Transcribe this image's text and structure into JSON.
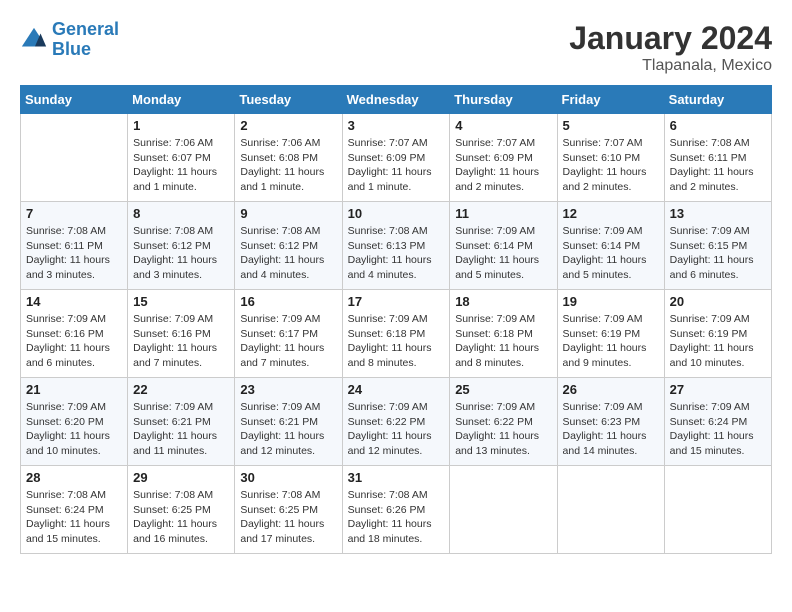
{
  "header": {
    "logo_line1": "General",
    "logo_line2": "Blue",
    "title": "January 2024",
    "subtitle": "Tlapanala, Mexico"
  },
  "weekdays": [
    "Sunday",
    "Monday",
    "Tuesday",
    "Wednesday",
    "Thursday",
    "Friday",
    "Saturday"
  ],
  "weeks": [
    [
      {
        "day": "",
        "info": ""
      },
      {
        "day": "1",
        "info": "Sunrise: 7:06 AM\nSunset: 6:07 PM\nDaylight: 11 hours\nand 1 minute."
      },
      {
        "day": "2",
        "info": "Sunrise: 7:06 AM\nSunset: 6:08 PM\nDaylight: 11 hours\nand 1 minute."
      },
      {
        "day": "3",
        "info": "Sunrise: 7:07 AM\nSunset: 6:09 PM\nDaylight: 11 hours\nand 1 minute."
      },
      {
        "day": "4",
        "info": "Sunrise: 7:07 AM\nSunset: 6:09 PM\nDaylight: 11 hours\nand 2 minutes."
      },
      {
        "day": "5",
        "info": "Sunrise: 7:07 AM\nSunset: 6:10 PM\nDaylight: 11 hours\nand 2 minutes."
      },
      {
        "day": "6",
        "info": "Sunrise: 7:08 AM\nSunset: 6:11 PM\nDaylight: 11 hours\nand 2 minutes."
      }
    ],
    [
      {
        "day": "7",
        "info": "Sunrise: 7:08 AM\nSunset: 6:11 PM\nDaylight: 11 hours\nand 3 minutes."
      },
      {
        "day": "8",
        "info": "Sunrise: 7:08 AM\nSunset: 6:12 PM\nDaylight: 11 hours\nand 3 minutes."
      },
      {
        "day": "9",
        "info": "Sunrise: 7:08 AM\nSunset: 6:12 PM\nDaylight: 11 hours\nand 4 minutes."
      },
      {
        "day": "10",
        "info": "Sunrise: 7:08 AM\nSunset: 6:13 PM\nDaylight: 11 hours\nand 4 minutes."
      },
      {
        "day": "11",
        "info": "Sunrise: 7:09 AM\nSunset: 6:14 PM\nDaylight: 11 hours\nand 5 minutes."
      },
      {
        "day": "12",
        "info": "Sunrise: 7:09 AM\nSunset: 6:14 PM\nDaylight: 11 hours\nand 5 minutes."
      },
      {
        "day": "13",
        "info": "Sunrise: 7:09 AM\nSunset: 6:15 PM\nDaylight: 11 hours\nand 6 minutes."
      }
    ],
    [
      {
        "day": "14",
        "info": "Sunrise: 7:09 AM\nSunset: 6:16 PM\nDaylight: 11 hours\nand 6 minutes."
      },
      {
        "day": "15",
        "info": "Sunrise: 7:09 AM\nSunset: 6:16 PM\nDaylight: 11 hours\nand 7 minutes."
      },
      {
        "day": "16",
        "info": "Sunrise: 7:09 AM\nSunset: 6:17 PM\nDaylight: 11 hours\nand 7 minutes."
      },
      {
        "day": "17",
        "info": "Sunrise: 7:09 AM\nSunset: 6:18 PM\nDaylight: 11 hours\nand 8 minutes."
      },
      {
        "day": "18",
        "info": "Sunrise: 7:09 AM\nSunset: 6:18 PM\nDaylight: 11 hours\nand 8 minutes."
      },
      {
        "day": "19",
        "info": "Sunrise: 7:09 AM\nSunset: 6:19 PM\nDaylight: 11 hours\nand 9 minutes."
      },
      {
        "day": "20",
        "info": "Sunrise: 7:09 AM\nSunset: 6:19 PM\nDaylight: 11 hours\nand 10 minutes."
      }
    ],
    [
      {
        "day": "21",
        "info": "Sunrise: 7:09 AM\nSunset: 6:20 PM\nDaylight: 11 hours\nand 10 minutes."
      },
      {
        "day": "22",
        "info": "Sunrise: 7:09 AM\nSunset: 6:21 PM\nDaylight: 11 hours\nand 11 minutes."
      },
      {
        "day": "23",
        "info": "Sunrise: 7:09 AM\nSunset: 6:21 PM\nDaylight: 11 hours\nand 12 minutes."
      },
      {
        "day": "24",
        "info": "Sunrise: 7:09 AM\nSunset: 6:22 PM\nDaylight: 11 hours\nand 12 minutes."
      },
      {
        "day": "25",
        "info": "Sunrise: 7:09 AM\nSunset: 6:22 PM\nDaylight: 11 hours\nand 13 minutes."
      },
      {
        "day": "26",
        "info": "Sunrise: 7:09 AM\nSunset: 6:23 PM\nDaylight: 11 hours\nand 14 minutes."
      },
      {
        "day": "27",
        "info": "Sunrise: 7:09 AM\nSunset: 6:24 PM\nDaylight: 11 hours\nand 15 minutes."
      }
    ],
    [
      {
        "day": "28",
        "info": "Sunrise: 7:08 AM\nSunset: 6:24 PM\nDaylight: 11 hours\nand 15 minutes."
      },
      {
        "day": "29",
        "info": "Sunrise: 7:08 AM\nSunset: 6:25 PM\nDaylight: 11 hours\nand 16 minutes."
      },
      {
        "day": "30",
        "info": "Sunrise: 7:08 AM\nSunset: 6:25 PM\nDaylight: 11 hours\nand 17 minutes."
      },
      {
        "day": "31",
        "info": "Sunrise: 7:08 AM\nSunset: 6:26 PM\nDaylight: 11 hours\nand 18 minutes."
      },
      {
        "day": "",
        "info": ""
      },
      {
        "day": "",
        "info": ""
      },
      {
        "day": "",
        "info": ""
      }
    ]
  ]
}
